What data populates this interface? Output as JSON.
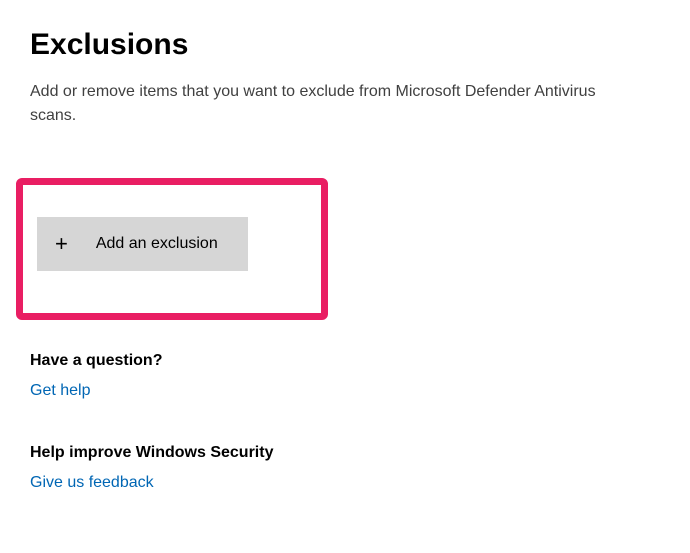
{
  "page": {
    "title": "Exclusions",
    "description": "Add or remove items that you want to exclude from Microsoft Defender Antivirus scans."
  },
  "actions": {
    "add_exclusion_label": "Add an exclusion"
  },
  "help": {
    "question_heading": "Have a question?",
    "get_help_label": "Get help"
  },
  "feedback": {
    "heading": "Help improve Windows Security",
    "link_label": "Give us feedback"
  }
}
